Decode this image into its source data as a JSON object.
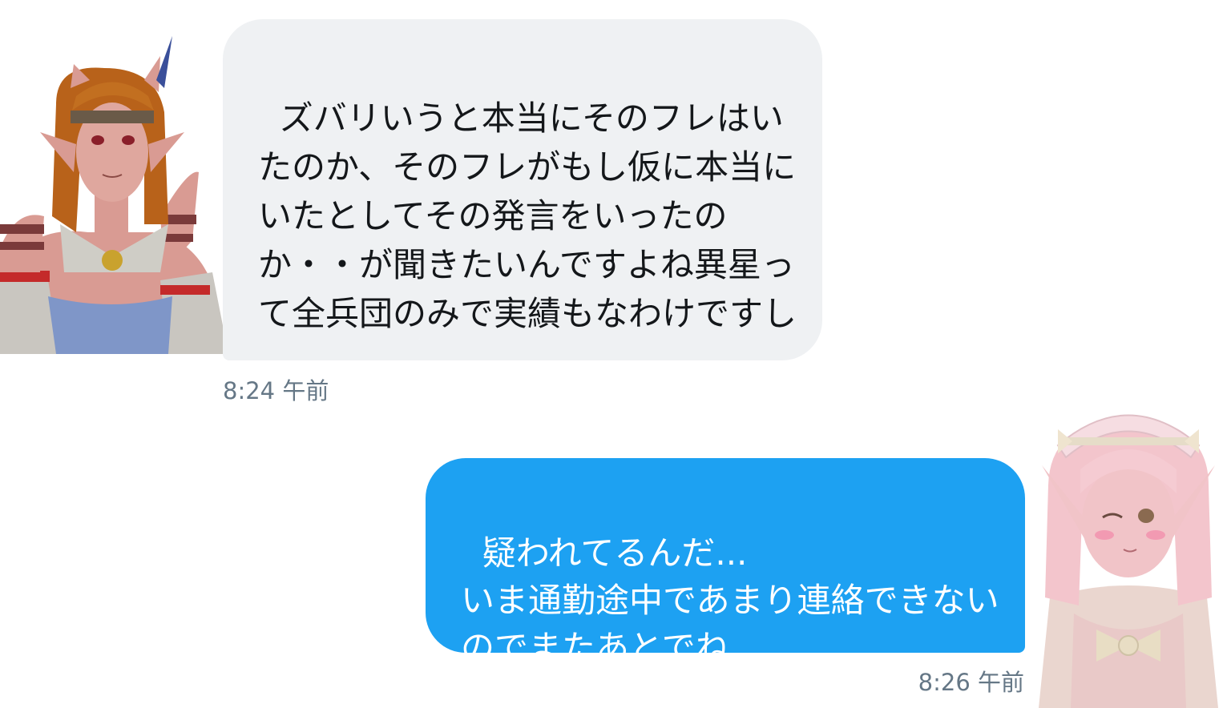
{
  "messages": [
    {
      "direction": "incoming",
      "text": "ズバリいうと本当にそのフレはいたのか、そのフレがもし仮に本当にいたとしてその発言をいったのか・・が聞きたいんですよね異星って全兵団のみで実績もなわけですし",
      "time": "8:24 午前",
      "avatar": "pink-elf-warrior-headband-avatar"
    },
    {
      "direction": "outgoing",
      "text": "疑われてるんだ...\nいま通勤途中であまり連絡できないのでまたあとでね",
      "time": "8:26 午前",
      "avatar": "pink-haired-maid-elf-avatar"
    }
  ],
  "colors": {
    "incoming_bubble": "#eff1f3",
    "incoming_text": "#14171a",
    "outgoing_bubble": "#1da1f2",
    "outgoing_text": "#ffffff",
    "timestamp": "#657786"
  }
}
